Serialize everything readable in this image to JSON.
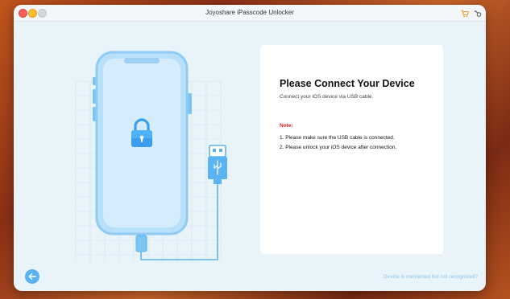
{
  "window": {
    "title": "Joyoshare iPasscode Unlocker"
  },
  "titlebar_icons": [
    "cart-icon",
    "key-icon"
  ],
  "main": {
    "heading": "Please Connect Your Device",
    "subtitle": "Connect your iOS device via USB cable.",
    "note_label": "Note:",
    "notes": [
      "1. Please make sure the USB cable is connected.",
      "2. Please unlock your iOS device after connection."
    ]
  },
  "footer": {
    "back_icon": "arrow-left-icon",
    "help_link": "Device is connected but not recognized?"
  },
  "colors": {
    "accent": "#5cb3f1",
    "phone_frame": "#9fd4f7",
    "note_red": "#e02020",
    "link": "#8cc4ec"
  }
}
